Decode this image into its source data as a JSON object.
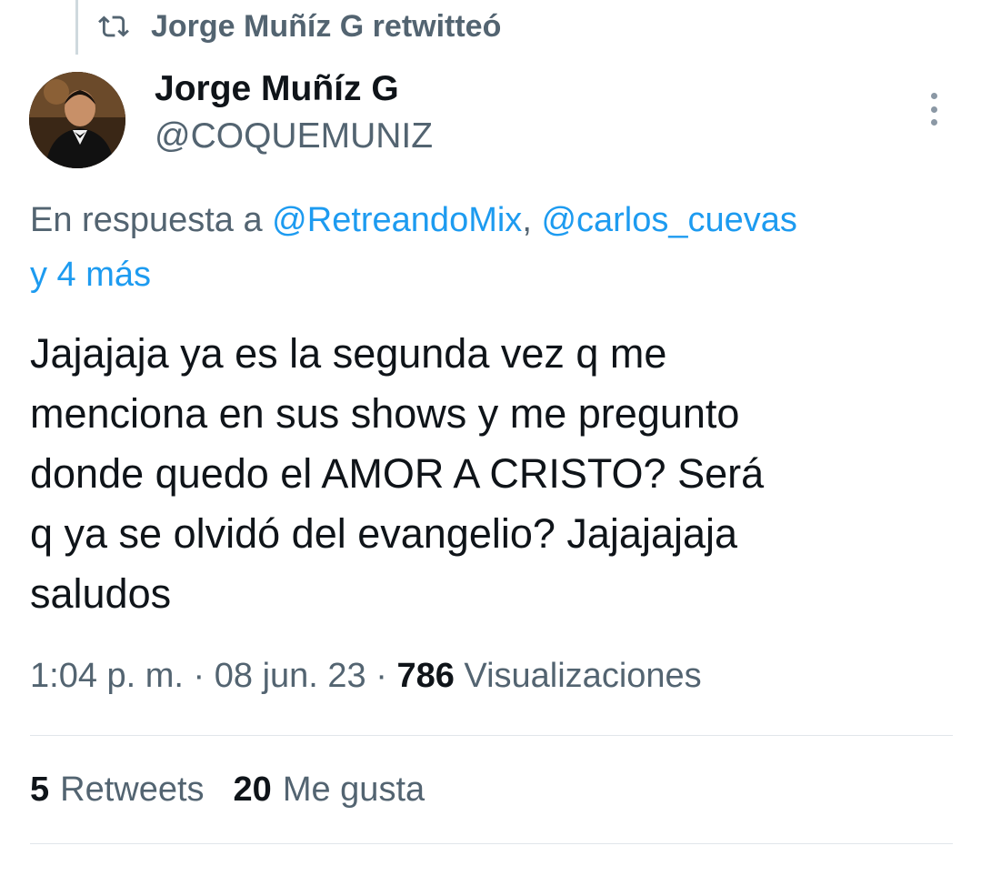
{
  "retweet_banner": {
    "icon": "retweet-icon",
    "text": "Jorge Muñíz G retwitteó"
  },
  "author": {
    "avatar": "profile-photo",
    "display_name": "Jorge Muñíz G",
    "handle": "@COQUEMUNIZ"
  },
  "menu": {
    "icon": "more-vertical-icon"
  },
  "reply": {
    "prefix": "En respuesta a ",
    "mention_1": "@RetreandoMix",
    "separator": ", ",
    "mention_2": "@carlos_cuevas",
    "suffix": "y 4 más"
  },
  "tweet": {
    "text": "Jajajaja ya es la segunda vez q me\nmenciona en sus shows y me pregunto\ndonde quedo el AMOR A CRISTO?  Será\nq ya se olvidó del evangelio? Jajajajaja\nsaludos"
  },
  "meta": {
    "time": "1:04 p. m.",
    "dot": " · ",
    "date": "08 jun. 23",
    "views_count": "786",
    "views_label": " Visualizaciones"
  },
  "stats": {
    "retweets_count": "5",
    "retweets_label": "Retweets",
    "likes_count": "20",
    "likes_label": "Me gusta"
  },
  "colors": {
    "link": "#1d9bf0",
    "secondary_text": "#536471",
    "primary_text": "#0f1419"
  }
}
